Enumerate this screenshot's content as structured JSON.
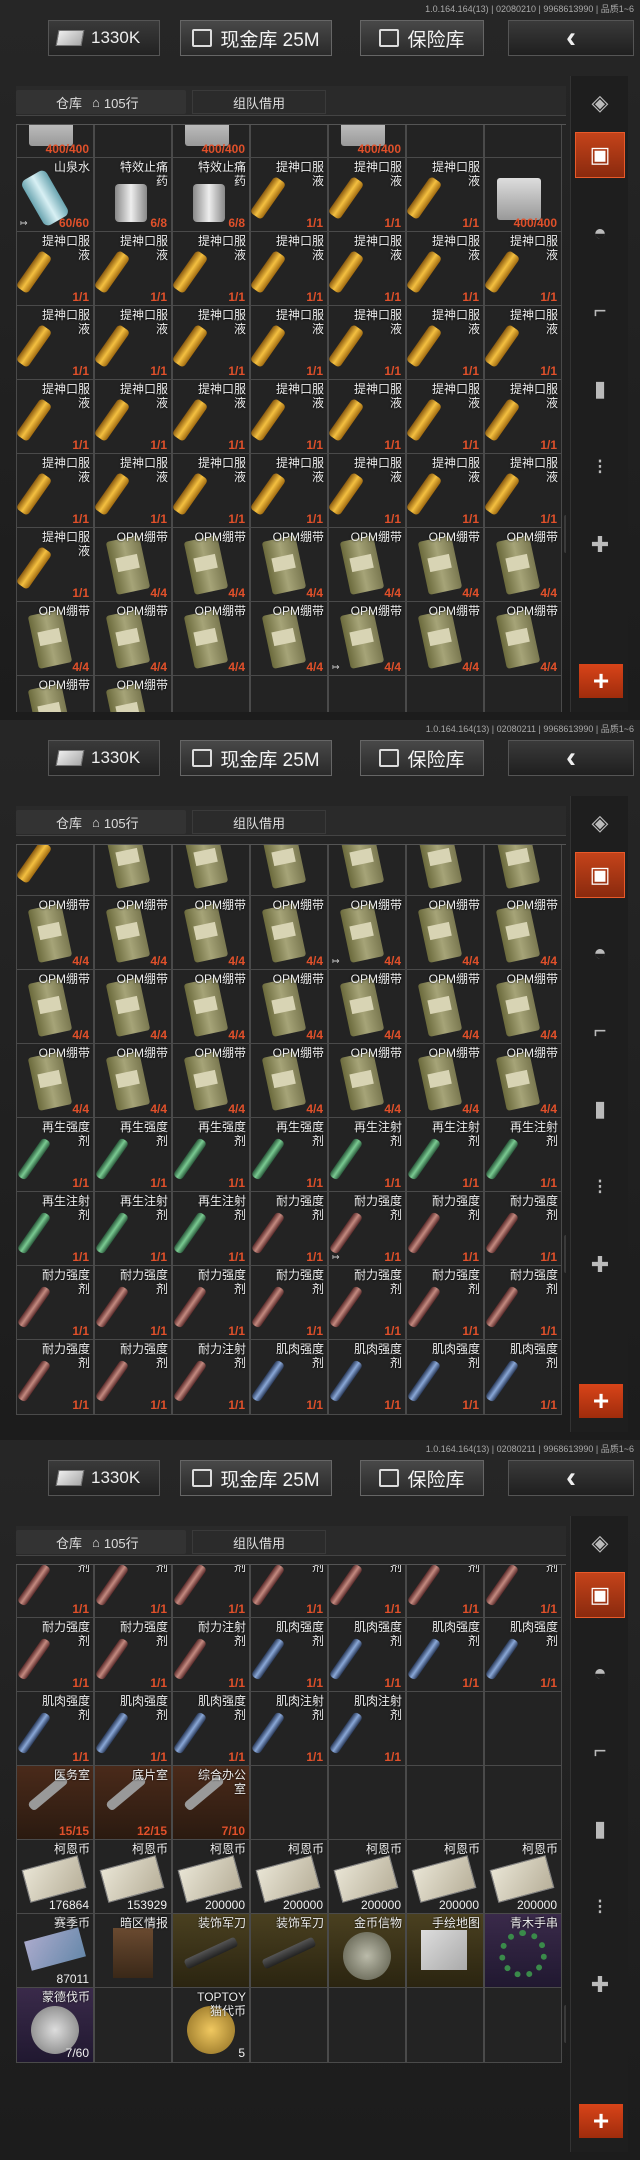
{
  "panels": [
    {
      "version": "1.0.164.164(13) | 02080210 | 9968613990 | 品质1~6",
      "money": "1330K",
      "cash_vault": "现金库 25M",
      "safe_vault": "保险库",
      "tab_warehouse": "仓库",
      "tab_rows": "105行",
      "tab_team": "组队借用",
      "rows": [
        [
          {
            "n": "",
            "q": "400/400",
            "t": "box"
          },
          {
            "n": "",
            "q": "",
            "t": "none"
          },
          {
            "n": "",
            "q": "400/400",
            "t": "box"
          },
          {
            "n": "",
            "q": "",
            "t": "none"
          },
          {
            "n": "",
            "q": "400/400",
            "t": "box"
          },
          {
            "n": "",
            "q": "",
            "t": "none"
          },
          {
            "n": "",
            "q": "",
            "t": "none"
          }
        ],
        [
          {
            "n": "山泉水",
            "q": "60/60",
            "t": "bottle",
            "m": "1"
          },
          {
            "n": "特效止痛药",
            "q": "6/8",
            "t": "can"
          },
          {
            "n": "特效止痛药",
            "q": "6/8",
            "t": "can"
          },
          {
            "n": "提神口服液",
            "q": "1/1",
            "t": "vial-gold"
          },
          {
            "n": "提神口服液",
            "q": "1/1",
            "t": "vial-gold"
          },
          {
            "n": "提神口服液",
            "q": "1/1",
            "t": "vial-gold"
          },
          {
            "n": "",
            "q": "400/400",
            "t": "box"
          }
        ],
        [
          {
            "n": "提神口服液",
            "q": "1/1",
            "t": "vial-gold"
          },
          {
            "n": "提神口服液",
            "q": "1/1",
            "t": "vial-gold"
          },
          {
            "n": "提神口服液",
            "q": "1/1",
            "t": "vial-gold"
          },
          {
            "n": "提神口服液",
            "q": "1/1",
            "t": "vial-gold"
          },
          {
            "n": "提神口服液",
            "q": "1/1",
            "t": "vial-gold"
          },
          {
            "n": "提神口服液",
            "q": "1/1",
            "t": "vial-gold"
          },
          {
            "n": "提神口服液",
            "q": "1/1",
            "t": "vial-gold"
          }
        ],
        [
          {
            "n": "提神口服液",
            "q": "1/1",
            "t": "vial-gold"
          },
          {
            "n": "提神口服液",
            "q": "1/1",
            "t": "vial-gold"
          },
          {
            "n": "提神口服液",
            "q": "1/1",
            "t": "vial-gold"
          },
          {
            "n": "提神口服液",
            "q": "1/1",
            "t": "vial-gold"
          },
          {
            "n": "提神口服液",
            "q": "1/1",
            "t": "vial-gold"
          },
          {
            "n": "提神口服液",
            "q": "1/1",
            "t": "vial-gold"
          },
          {
            "n": "提神口服液",
            "q": "1/1",
            "t": "vial-gold"
          }
        ],
        [
          {
            "n": "提神口服液",
            "q": "1/1",
            "t": "vial-gold"
          },
          {
            "n": "提神口服液",
            "q": "1/1",
            "t": "vial-gold"
          },
          {
            "n": "提神口服液",
            "q": "1/1",
            "t": "vial-gold"
          },
          {
            "n": "提神口服液",
            "q": "1/1",
            "t": "vial-gold"
          },
          {
            "n": "提神口服液",
            "q": "1/1",
            "t": "vial-gold"
          },
          {
            "n": "提神口服液",
            "q": "1/1",
            "t": "vial-gold"
          },
          {
            "n": "提神口服液",
            "q": "1/1",
            "t": "vial-gold"
          }
        ],
        [
          {
            "n": "提神口服液",
            "q": "1/1",
            "t": "vial-gold"
          },
          {
            "n": "提神口服液",
            "q": "1/1",
            "t": "vial-gold"
          },
          {
            "n": "提神口服液",
            "q": "1/1",
            "t": "vial-gold"
          },
          {
            "n": "提神口服液",
            "q": "1/1",
            "t": "vial-gold"
          },
          {
            "n": "提神口服液",
            "q": "1/1",
            "t": "vial-gold"
          },
          {
            "n": "提神口服液",
            "q": "1/1",
            "t": "vial-gold"
          },
          {
            "n": "提神口服液",
            "q": "1/1",
            "t": "vial-gold"
          }
        ],
        [
          {
            "n": "提神口服液",
            "q": "1/1",
            "t": "vial-gold"
          },
          {
            "n": "OPM绷带",
            "q": "4/4",
            "t": "bandage"
          },
          {
            "n": "OPM绷带",
            "q": "4/4",
            "t": "bandage"
          },
          {
            "n": "OPM绷带",
            "q": "4/4",
            "t": "bandage"
          },
          {
            "n": "OPM绷带",
            "q": "4/4",
            "t": "bandage"
          },
          {
            "n": "OPM绷带",
            "q": "4/4",
            "t": "bandage"
          },
          {
            "n": "OPM绷带",
            "q": "4/4",
            "t": "bandage"
          }
        ],
        [
          {
            "n": "OPM绷带",
            "q": "4/4",
            "t": "bandage"
          },
          {
            "n": "OPM绷带",
            "q": "4/4",
            "t": "bandage"
          },
          {
            "n": "OPM绷带",
            "q": "4/4",
            "t": "bandage"
          },
          {
            "n": "OPM绷带",
            "q": "4/4",
            "t": "bandage"
          },
          {
            "n": "OPM绷带",
            "q": "4/4",
            "t": "bandage",
            "m": "1"
          },
          {
            "n": "OPM绷带",
            "q": "4/4",
            "t": "bandage"
          },
          {
            "n": "OPM绷带",
            "q": "4/4",
            "t": "bandage"
          }
        ],
        [
          {
            "n": "OPM绷带",
            "q": "",
            "t": "bandage"
          },
          {
            "n": "OPM绷带",
            "q": "",
            "t": "bandage"
          },
          {
            "n": "",
            "q": "",
            "t": "none"
          },
          {
            "n": "",
            "q": "",
            "t": "none"
          },
          {
            "n": "",
            "q": "",
            "t": "none"
          },
          {
            "n": "",
            "q": "",
            "t": "none"
          },
          {
            "n": "",
            "q": "",
            "t": "none"
          }
        ]
      ]
    },
    {
      "version": "1.0.164.164(13) | 02080211 | 9968613990 | 品质1~6",
      "money": "1330K",
      "cash_vault": "现金库 25M",
      "safe_vault": "保险库",
      "tab_warehouse": "仓库",
      "tab_rows": "105行",
      "tab_team": "组队借用",
      "rows": [
        [
          {
            "n": "液",
            "q": "",
            "t": "vial-gold"
          },
          {
            "n": "",
            "q": "",
            "t": "bandage"
          },
          {
            "n": "",
            "q": "",
            "t": "bandage"
          },
          {
            "n": "",
            "q": "",
            "t": "bandage"
          },
          {
            "n": "",
            "q": "",
            "t": "bandage"
          },
          {
            "n": "",
            "q": "",
            "t": "bandage"
          },
          {
            "n": "",
            "q": "",
            "t": "bandage"
          }
        ],
        [
          {
            "n": "OPM绷带",
            "q": "4/4",
            "t": "bandage"
          },
          {
            "n": "OPM绷带",
            "q": "4/4",
            "t": "bandage"
          },
          {
            "n": "OPM绷带",
            "q": "4/4",
            "t": "bandage"
          },
          {
            "n": "OPM绷带",
            "q": "4/4",
            "t": "bandage"
          },
          {
            "n": "OPM绷带",
            "q": "4/4",
            "t": "bandage",
            "m": "1"
          },
          {
            "n": "OPM绷带",
            "q": "4/4",
            "t": "bandage"
          },
          {
            "n": "OPM绷带",
            "q": "4/4",
            "t": "bandage"
          }
        ],
        [
          {
            "n": "OPM绷带",
            "q": "4/4",
            "t": "bandage"
          },
          {
            "n": "OPM绷带",
            "q": "4/4",
            "t": "bandage"
          },
          {
            "n": "OPM绷带",
            "q": "4/4",
            "t": "bandage"
          },
          {
            "n": "OPM绷带",
            "q": "4/4",
            "t": "bandage"
          },
          {
            "n": "OPM绷带",
            "q": "4/4",
            "t": "bandage"
          },
          {
            "n": "OPM绷带",
            "q": "4/4",
            "t": "bandage"
          },
          {
            "n": "OPM绷带",
            "q": "4/4",
            "t": "bandage"
          }
        ],
        [
          {
            "n": "OPM绷带",
            "q": "4/4",
            "t": "bandage"
          },
          {
            "n": "OPM绷带",
            "q": "4/4",
            "t": "bandage"
          },
          {
            "n": "OPM绷带",
            "q": "4/4",
            "t": "bandage"
          },
          {
            "n": "OPM绷带",
            "q": "4/4",
            "t": "bandage"
          },
          {
            "n": "OPM绷带",
            "q": "4/4",
            "t": "bandage"
          },
          {
            "n": "OPM绷带",
            "q": "4/4",
            "t": "bandage"
          },
          {
            "n": "OPM绷带",
            "q": "4/4",
            "t": "bandage"
          }
        ],
        [
          {
            "n": "再生强度剂",
            "q": "1/1",
            "t": "vial g"
          },
          {
            "n": "再生强度剂",
            "q": "1/1",
            "t": "vial g"
          },
          {
            "n": "再生强度剂",
            "q": "1/1",
            "t": "vial g"
          },
          {
            "n": "再生强度剂",
            "q": "1/1",
            "t": "vial g"
          },
          {
            "n": "再生注射剂",
            "q": "1/1",
            "t": "vial g"
          },
          {
            "n": "再生注射剂",
            "q": "1/1",
            "t": "vial g"
          },
          {
            "n": "再生注射剂",
            "q": "1/1",
            "t": "vial g"
          }
        ],
        [
          {
            "n": "再生注射剂",
            "q": "1/1",
            "t": "vial g"
          },
          {
            "n": "再生注射剂",
            "q": "1/1",
            "t": "vial g"
          },
          {
            "n": "再生注射剂",
            "q": "1/1",
            "t": "vial g"
          },
          {
            "n": "耐力强度剂",
            "q": "1/1",
            "t": "vial r"
          },
          {
            "n": "耐力强度剂",
            "q": "1/1",
            "t": "vial r",
            "m": "1"
          },
          {
            "n": "耐力强度剂",
            "q": "1/1",
            "t": "vial r"
          },
          {
            "n": "耐力强度剂",
            "q": "1/1",
            "t": "vial r"
          }
        ],
        [
          {
            "n": "耐力强度剂",
            "q": "1/1",
            "t": "vial r"
          },
          {
            "n": "耐力强度剂",
            "q": "1/1",
            "t": "vial r"
          },
          {
            "n": "耐力强度剂",
            "q": "1/1",
            "t": "vial r"
          },
          {
            "n": "耐力强度剂",
            "q": "1/1",
            "t": "vial r"
          },
          {
            "n": "耐力强度剂",
            "q": "1/1",
            "t": "vial r"
          },
          {
            "n": "耐力强度剂",
            "q": "1/1",
            "t": "vial r"
          },
          {
            "n": "耐力强度剂",
            "q": "1/1",
            "t": "vial r"
          }
        ],
        [
          {
            "n": "耐力强度剂",
            "q": "1/1",
            "t": "vial r"
          },
          {
            "n": "耐力强度剂",
            "q": "1/1",
            "t": "vial r"
          },
          {
            "n": "耐力注射剂",
            "q": "1/1",
            "t": "vial r"
          },
          {
            "n": "肌肉强度剂",
            "q": "1/1",
            "t": "vial b"
          },
          {
            "n": "肌肉强度剂",
            "q": "1/1",
            "t": "vial b"
          },
          {
            "n": "肌肉强度剂",
            "q": "1/1",
            "t": "vial b"
          },
          {
            "n": "肌肉强度剂",
            "q": "1/1",
            "t": "vial b"
          }
        ]
      ]
    },
    {
      "version": "1.0.164.164(13) | 02080211 | 9968613990 | 品质1~6",
      "money": "1330K",
      "cash_vault": "现金库 25M",
      "safe_vault": "保险库",
      "tab_warehouse": "仓库",
      "tab_rows": "105行",
      "tab_team": "组队借用",
      "rows": [
        [
          {
            "n": "耐力强度剂",
            "q": "1/1",
            "t": "vial r"
          },
          {
            "n": "耐力强度剂",
            "q": "1/1",
            "t": "vial r"
          },
          {
            "n": "耐力强度剂",
            "q": "1/1",
            "t": "vial r"
          },
          {
            "n": "耐力强度剂",
            "q": "1/1",
            "t": "vial r"
          },
          {
            "n": "耐力强度剂",
            "q": "1/1",
            "t": "vial r"
          },
          {
            "n": "耐力强度剂",
            "q": "1/1",
            "t": "vial r"
          },
          {
            "n": "耐力强度剂",
            "q": "1/1",
            "t": "vial r"
          }
        ],
        [
          {
            "n": "耐力强度剂",
            "q": "1/1",
            "t": "vial r"
          },
          {
            "n": "耐力强度剂",
            "q": "1/1",
            "t": "vial r"
          },
          {
            "n": "耐力注射剂",
            "q": "1/1",
            "t": "vial r"
          },
          {
            "n": "肌肉强度剂",
            "q": "1/1",
            "t": "vial b"
          },
          {
            "n": "肌肉强度剂",
            "q": "1/1",
            "t": "vial b"
          },
          {
            "n": "肌肉强度剂",
            "q": "1/1",
            "t": "vial b"
          },
          {
            "n": "肌肉强度剂",
            "q": "1/1",
            "t": "vial b"
          }
        ],
        [
          {
            "n": "肌肉强度剂",
            "q": "1/1",
            "t": "vial b"
          },
          {
            "n": "肌肉强度剂",
            "q": "1/1",
            "t": "vial b"
          },
          {
            "n": "肌肉强度剂",
            "q": "1/1",
            "t": "vial b"
          },
          {
            "n": "肌肉注射剂",
            "q": "1/1",
            "t": "vial b"
          },
          {
            "n": "肌肉注射剂",
            "q": "1/1",
            "t": "vial b"
          },
          {
            "n": "",
            "q": "",
            "t": "none"
          },
          {
            "n": "",
            "q": "",
            "t": "none"
          }
        ],
        [
          {
            "n": "医务室",
            "q": "15/15",
            "t": "keyic",
            "c": "key"
          },
          {
            "n": "底片室",
            "q": "12/15",
            "t": "keyic",
            "c": "key"
          },
          {
            "n": "综合办公室",
            "q": "7/10",
            "t": "keyic",
            "c": "key"
          },
          {
            "n": "",
            "q": "",
            "t": "none"
          },
          {
            "n": "",
            "q": "",
            "t": "none"
          },
          {
            "n": "",
            "q": "",
            "t": "none"
          },
          {
            "n": "",
            "q": "",
            "t": "none"
          }
        ],
        [
          {
            "n": "柯恩币",
            "q": "176864",
            "t": "cash",
            "w": "1"
          },
          {
            "n": "柯恩币",
            "q": "153929",
            "t": "cash",
            "w": "1"
          },
          {
            "n": "柯恩币",
            "q": "200000",
            "t": "cash",
            "w": "1"
          },
          {
            "n": "柯恩币",
            "q": "200000",
            "t": "cash",
            "w": "1"
          },
          {
            "n": "柯恩币",
            "q": "200000",
            "t": "cash",
            "w": "1"
          },
          {
            "n": "柯恩币",
            "q": "200000",
            "t": "cash",
            "w": "1"
          },
          {
            "n": "柯恩币",
            "q": "200000",
            "t": "cash",
            "w": "1"
          }
        ],
        [
          {
            "n": "赛季币",
            "q": "87011",
            "t": "flashcard",
            "w": "1"
          },
          {
            "n": "暗区情报",
            "q": "",
            "t": "book"
          },
          {
            "n": "装饰军刀",
            "q": "",
            "t": "knife",
            "c": "gold"
          },
          {
            "n": "装饰军刀",
            "q": "",
            "t": "knife",
            "c": "gold"
          },
          {
            "n": "金币信物",
            "q": "",
            "t": "coin m",
            "c": "gold"
          },
          {
            "n": "手绘地图",
            "q": "",
            "t": "mapic",
            "c": "gold"
          },
          {
            "n": "青木手串",
            "q": "",
            "t": "beads",
            "c": "purp"
          }
        ],
        [
          {
            "n": "蒙德伐币",
            "q": "7/60",
            "t": "coin s",
            "c": "purp",
            "w": "1"
          },
          {
            "n": "",
            "q": "",
            "t": "none"
          },
          {
            "n": "TOPTOY 猫代币",
            "q": "5",
            "t": "coin g",
            "w": "1"
          },
          {
            "n": "",
            "q": "",
            "t": "none"
          },
          {
            "n": "",
            "q": "",
            "t": "none"
          },
          {
            "n": "",
            "q": "",
            "t": "none"
          },
          {
            "n": "",
            "q": "",
            "t": "none"
          }
        ]
      ]
    }
  ],
  "sidebar_icons": [
    "stack-icon",
    "selected-bag-icon",
    "helmet-icon",
    "rifle-icon",
    "magazine-icon",
    "ammo-icon",
    "gear-icon"
  ],
  "colors": {
    "accent": "#c4431a",
    "qty_red": "#e0502a"
  }
}
